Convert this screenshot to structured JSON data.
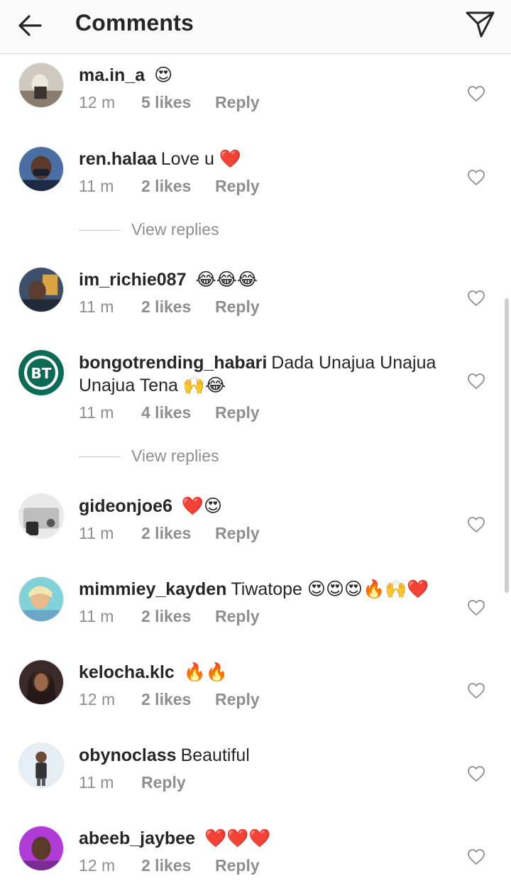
{
  "header": {
    "title": "Comments"
  },
  "comments": [
    {
      "username": "ma.in_a",
      "text": "",
      "emoji": "😍",
      "time": "12 m",
      "likes": "5 likes",
      "reply": "Reply"
    },
    {
      "username": "ren.halaa",
      "text": "Love u",
      "emoji": "❤️",
      "time": "11 m",
      "likes": "2 likes",
      "reply": "Reply"
    },
    {
      "username": "im_richie087",
      "text": "",
      "emoji": "😂😂😂",
      "time": "11 m",
      "likes": "2 likes",
      "reply": "Reply"
    },
    {
      "username": "bongotrending_habari",
      "text": "Dada Unajua Unajua Unajua Tena",
      "emoji": "🙌😂",
      "time": "11 m",
      "likes": "4 likes",
      "reply": "Reply"
    },
    {
      "username": "gideonjoe6",
      "text": "",
      "emoji": "❤️😍",
      "time": "11 m",
      "likes": "2 likes",
      "reply": "Reply"
    },
    {
      "username": "mimmiey_kayden",
      "text": "Tiwatope",
      "emoji": "😍😍😍🔥🙌❤️",
      "time": "11 m",
      "likes": "2 likes",
      "reply": "Reply"
    },
    {
      "username": "kelocha.klc",
      "text": "",
      "emoji": "🔥🔥",
      "time": "12 m",
      "likes": "2 likes",
      "reply": "Reply"
    },
    {
      "username": "obynoclass",
      "text": "Beautiful",
      "emoji": "",
      "time": "11 m",
      "likes": "",
      "reply": "Reply"
    },
    {
      "username": "abeeb_jaybee",
      "text": "",
      "emoji": "❤️❤️❤️",
      "time": "12 m",
      "likes": "2 likes",
      "reply": "Reply"
    }
  ],
  "view_replies_label": "View replies",
  "bongo_avatar_initials": "BT",
  "icons": {
    "back": "arrow-left-icon",
    "send": "paper-plane-icon",
    "like": "heart-outline-icon"
  },
  "colors": {
    "primary_text": "#262626",
    "secondary_text": "#8e8e8e",
    "bongo_brand": "#0b6b57"
  }
}
